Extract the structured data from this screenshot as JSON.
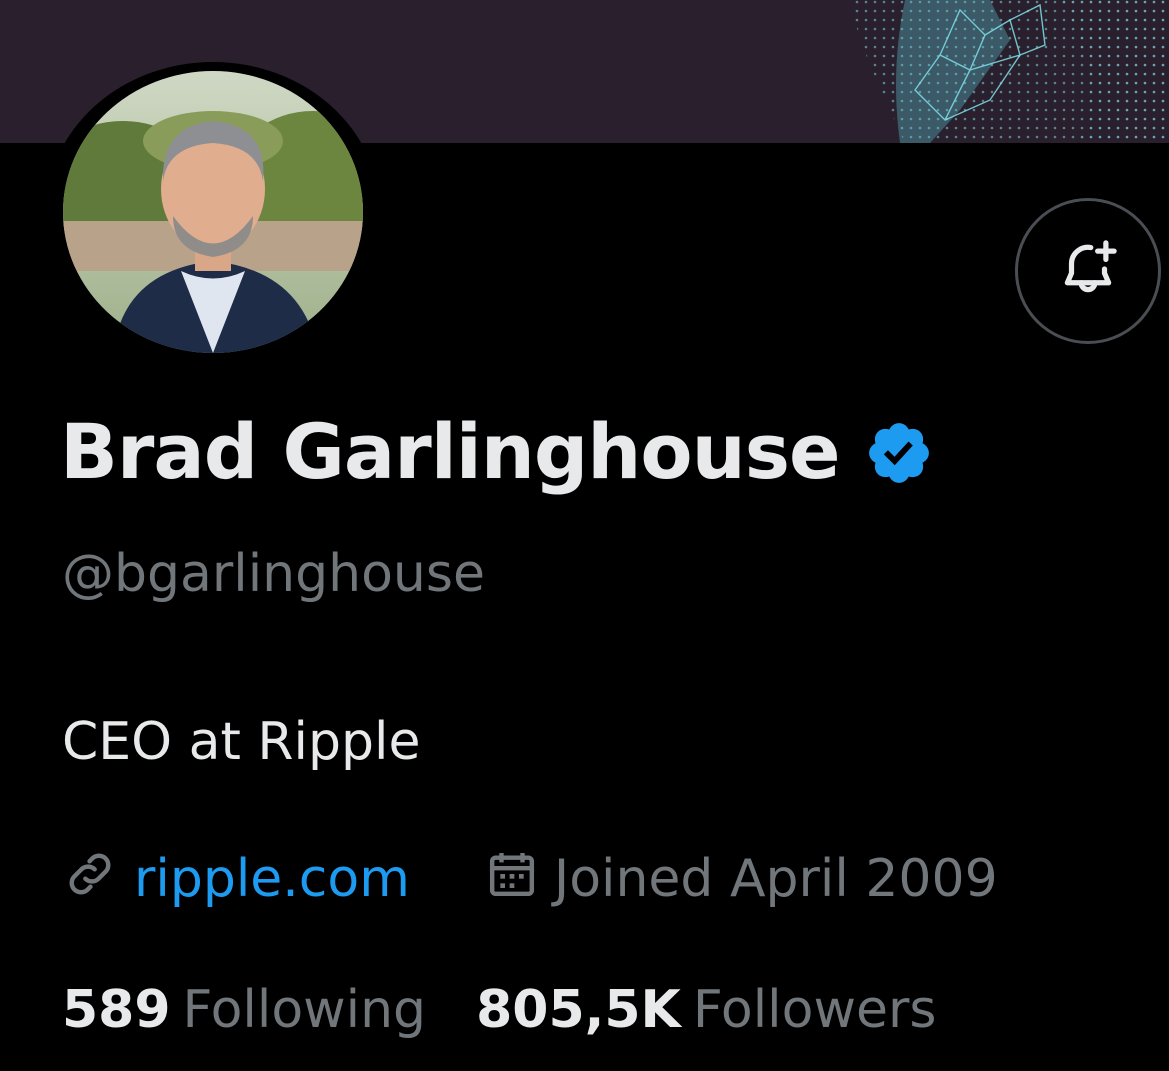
{
  "profile": {
    "name": "Brad Garlinghouse",
    "handle": "@bgarlinghouse",
    "bio": "CEO at Ripple",
    "website": "ripple.com",
    "joined": "Joined April 2009",
    "following_count": "589",
    "following_label": "Following",
    "followers_count": "805,5K",
    "followers_label": "Followers"
  },
  "icons": {
    "verified": "verified-badge-icon",
    "notify": "bell-plus-icon",
    "link": "link-icon",
    "calendar": "calendar-icon"
  },
  "colors": {
    "background": "#000000",
    "banner": "#2a1f2d",
    "primary_text": "#e7e9ea",
    "secondary_text": "#71767b",
    "link": "#1d9bf0",
    "verified": "#1d9bf0"
  }
}
